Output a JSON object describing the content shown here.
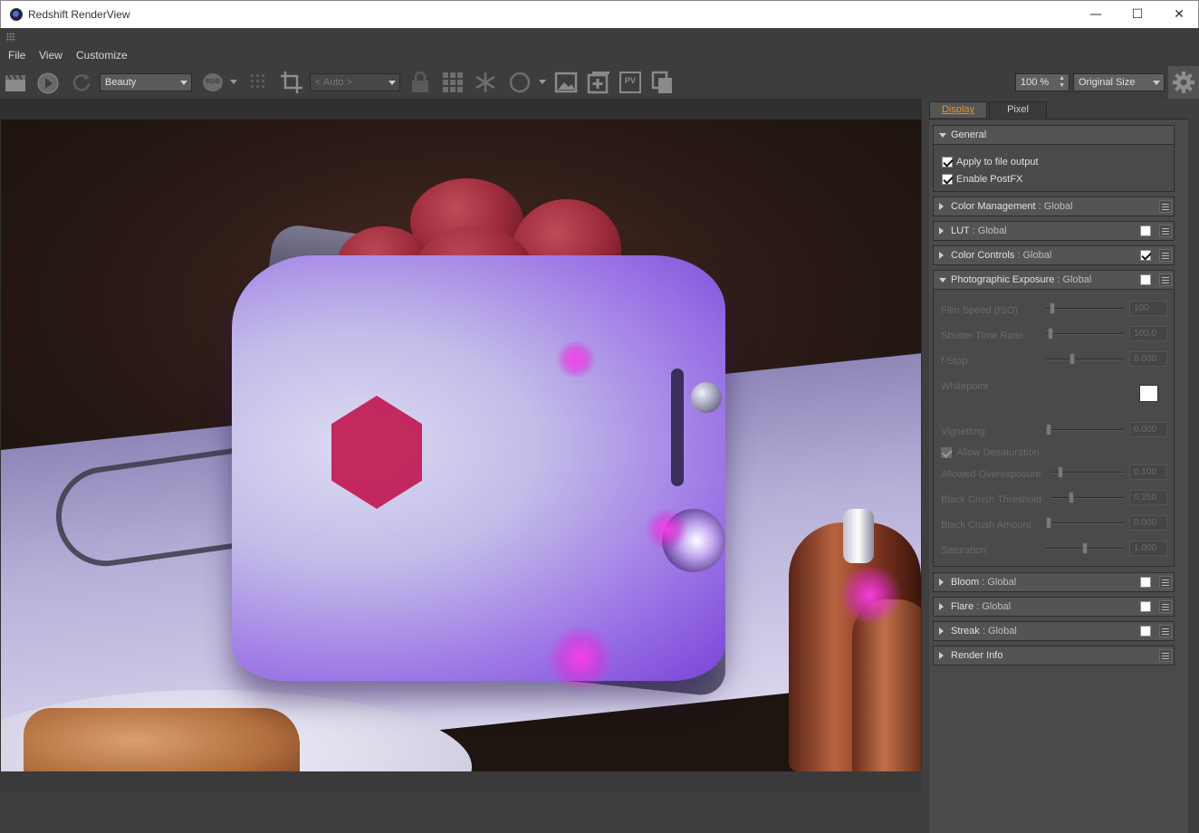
{
  "window": {
    "title": "Redshift RenderView",
    "minimize_glyph": "—",
    "maximize_glyph": "☐",
    "close_glyph": "✕",
    "icon": "redshift-app-icon"
  },
  "menu": {
    "file": "File",
    "view": "View",
    "customize": "Customize"
  },
  "toolbar": {
    "aov_select": "Beauty",
    "rgb_label": "RGB",
    "region_select": "< Auto >",
    "pv_label": "PV",
    "zoom_value": "100 %",
    "size_select": "Original Size",
    "icons": [
      "clapperboard-icon",
      "play-icon",
      "refresh-icon",
      "grid-dots-icon",
      "crop-icon",
      "lock-icon",
      "grid-icon",
      "snowflake-icon",
      "circle-icon",
      "image-icon",
      "image-add-icon",
      "pv-icon",
      "copy-image-icon",
      "gear-icon"
    ]
  },
  "panel": {
    "tabs": {
      "display": "Display",
      "pixel": "Pixel"
    },
    "general": {
      "title": "General",
      "apply_to_file_output": "Apply to file output",
      "enable_postfx": "Enable PostFX"
    },
    "sections": {
      "color_management": {
        "name": "Color Management",
        "scope": " : Global"
      },
      "lut": {
        "name": "LUT",
        "scope": " : Global"
      },
      "color_controls": {
        "name": "Color Controls",
        "scope": " : Global"
      },
      "photographic_exposure": {
        "name": "Photographic Exposure",
        "scope": " : Global"
      },
      "bloom": {
        "name": "Bloom",
        "scope": " : Global"
      },
      "flare": {
        "name": "Flare",
        "scope": " : Global"
      },
      "streak": {
        "name": "Streak",
        "scope": " : Global"
      },
      "render_info": {
        "name": "Render Info"
      }
    },
    "exposure": {
      "film_speed": {
        "label": "Film Speed (ISO)",
        "value": "100",
        "level": 0.05
      },
      "shutter_time_ratio": {
        "label": "Shutter Time Ratio",
        "value": "100.0",
        "level": 0.03
      },
      "fstop": {
        "label": "f-Stop",
        "value": "8.000",
        "level": 0.33
      },
      "whitepoint": {
        "label": "Whitepoint",
        "color": "#ffffff"
      },
      "vignetting": {
        "label": "Vignetting",
        "value": "0.000",
        "level": 0.0
      },
      "allow_desaturation": {
        "label": "Allow Desaturation"
      },
      "allowed_overexposure": {
        "label": "Allowed Overexposure",
        "value": "0.100",
        "level": 0.1
      },
      "black_crush_threshold": {
        "label": "Black Crush Threshold",
        "value": "0.250",
        "level": 0.25
      },
      "black_crush_amount": {
        "label": "Black Crush Amount",
        "value": "0.000",
        "level": 0.0
      },
      "saturation": {
        "label": "Saturation",
        "value": "1.000",
        "level": 0.5
      }
    }
  },
  "colors": {
    "accent_tab": "#e8922a",
    "panel_bg": "#4a4a4a"
  }
}
